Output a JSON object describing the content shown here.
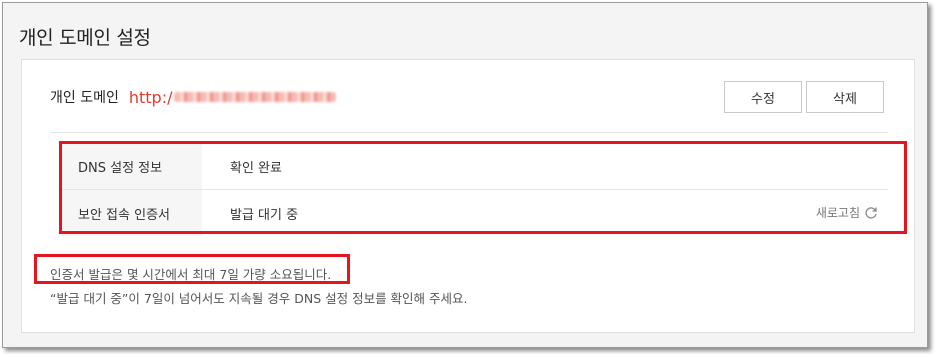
{
  "page": {
    "title": "개인 도메인 설정"
  },
  "domain": {
    "label": "개인 도메인",
    "value_prefix": "http:/"
  },
  "buttons": {
    "edit": "수정",
    "delete": "삭제"
  },
  "info": {
    "rows": [
      {
        "key": "DNS 설정 정보",
        "value": "확인 완료"
      },
      {
        "key": "보안 접속 인증서",
        "value": "발급 대기 중"
      }
    ],
    "refresh_label": "새로고침"
  },
  "notes": {
    "line1": "인증서 발급은 몇 시간에서 최대 7일 가량 소요됩니다.",
    "line2": "“발급 대기 중”이 7일이 넘어서도 지속될 경우 DNS 설정 정보를 확인해 주세요."
  },
  "colors": {
    "highlight": "#e4151f",
    "domain_text": "#e23b2e"
  }
}
